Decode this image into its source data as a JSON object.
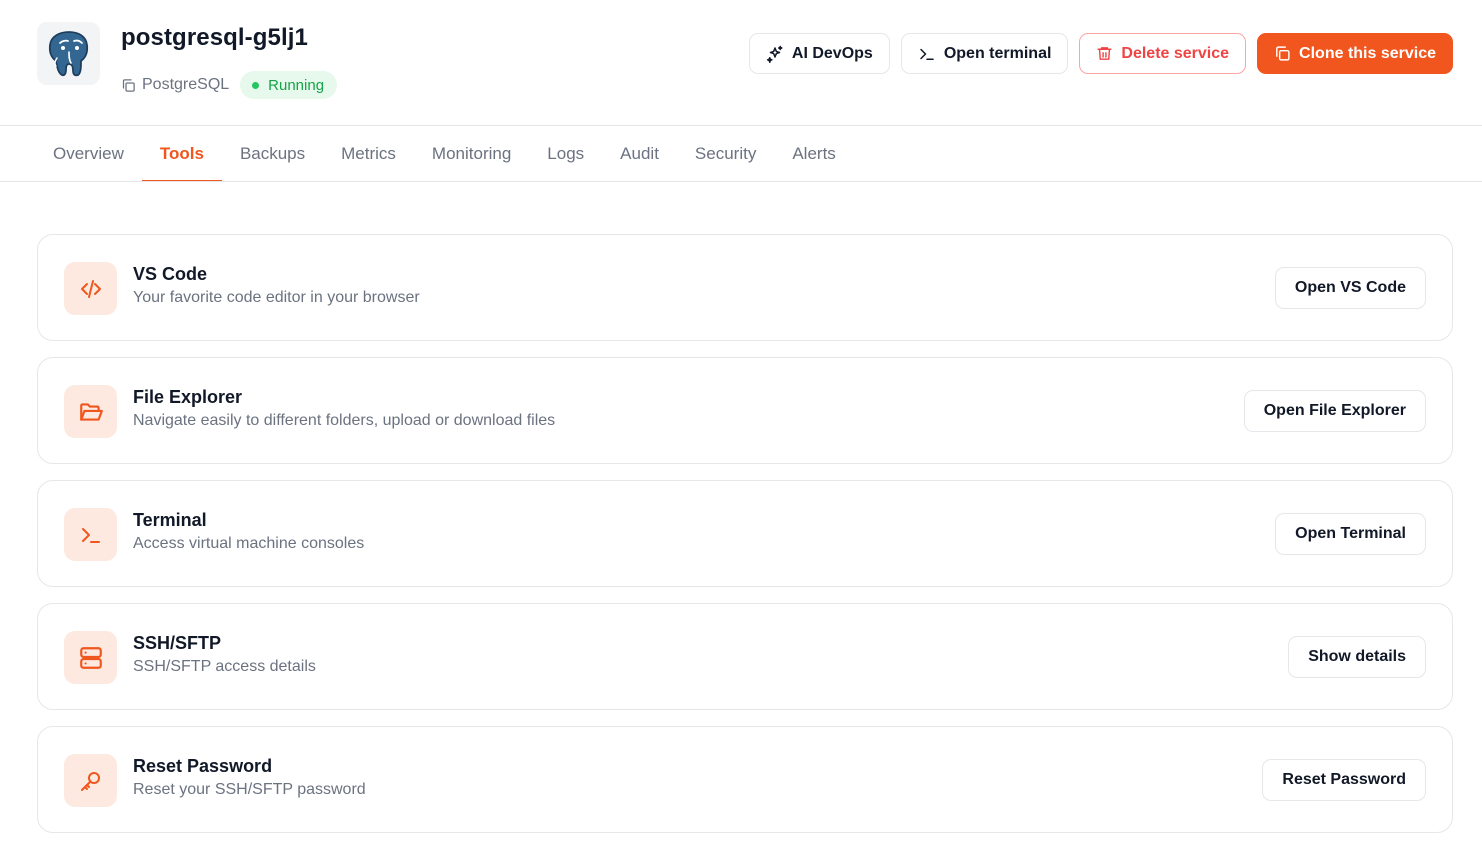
{
  "service": {
    "name": "postgresql-g5lj1",
    "type": "PostgreSQL",
    "status": "Running",
    "logo": "postgresql-elephant-icon"
  },
  "actions": {
    "ai_devops": "AI DevOps",
    "open_terminal": "Open terminal",
    "delete_service": "Delete service",
    "clone_service": "Clone this service"
  },
  "tabs": [
    {
      "label": "Overview",
      "active": false
    },
    {
      "label": "Tools",
      "active": true
    },
    {
      "label": "Backups",
      "active": false
    },
    {
      "label": "Metrics",
      "active": false
    },
    {
      "label": "Monitoring",
      "active": false
    },
    {
      "label": "Logs",
      "active": false
    },
    {
      "label": "Audit",
      "active": false
    },
    {
      "label": "Security",
      "active": false
    },
    {
      "label": "Alerts",
      "active": false
    }
  ],
  "tools": [
    {
      "icon": "code-icon",
      "title": "VS Code",
      "description": "Your favorite code editor in your browser",
      "button": "Open VS Code"
    },
    {
      "icon": "folder-open-icon",
      "title": "File Explorer",
      "description": "Navigate easily to different folders, upload or download files",
      "button": "Open File Explorer"
    },
    {
      "icon": "terminal-icon",
      "title": "Terminal",
      "description": "Access virtual machine consoles",
      "button": "Open Terminal"
    },
    {
      "icon": "server-icon",
      "title": "SSH/SFTP",
      "description": "SSH/SFTP access details",
      "button": "Show details"
    },
    {
      "icon": "key-icon",
      "title": "Reset Password",
      "description": "Reset your SSH/SFTP password",
      "button": "Reset Password"
    }
  ],
  "colors": {
    "accent": "#f0561d",
    "danger": "#ef4444",
    "success": "#16a34a",
    "icon_bg": "#fde9e0"
  }
}
